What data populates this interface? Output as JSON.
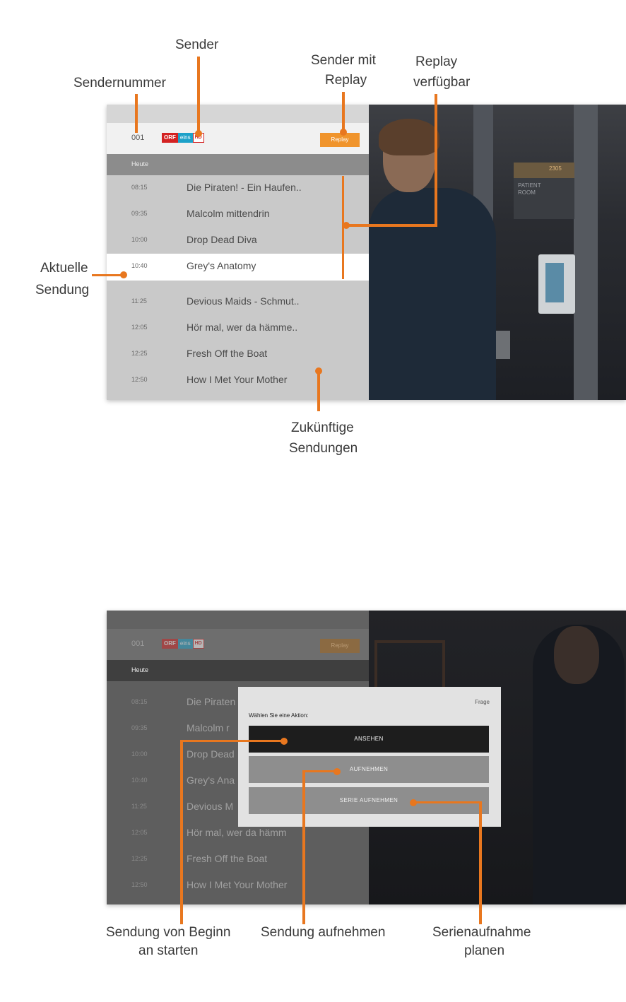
{
  "callouts": {
    "sendernummer": "Sendernummer",
    "sender": "Sender",
    "sender_mit_replay_1": "Sender mit",
    "sender_mit_replay_2": "Replay",
    "replay_verfuegbar_1": "Replay",
    "replay_verfuegbar_2": "verfügbar",
    "aktuelle_1": "Aktuelle",
    "aktuelle_2": "Sendung",
    "zukuenftige_1": "Zukünftige",
    "zukuenftige_2": "Sendungen",
    "von_beginn_1": "Sendung von Beginn",
    "von_beginn_2": "an starten",
    "aufnehmen": "Sendung aufnehmen",
    "serie_1": "Serienaufnahme",
    "serie_2": "planen"
  },
  "channel": {
    "number": "001",
    "logo_part1": "ORF",
    "logo_part2": "eins",
    "logo_part3": "HD",
    "replay_label": "Replay",
    "day_label": "Heute"
  },
  "programs": [
    {
      "time": "08:15",
      "title": "Die Piraten! - Ein Haufen.."
    },
    {
      "time": "09:35",
      "title": "Malcolm mittendrin"
    },
    {
      "time": "10:00",
      "title": "Drop Dead Diva"
    },
    {
      "time": "10:40",
      "title": "Grey's Anatomy"
    },
    {
      "time": "11:25",
      "title": "Devious Maids - Schmut.."
    },
    {
      "time": "12:05",
      "title": "Hör mal, wer da hämme.."
    },
    {
      "time": "12:25",
      "title": "Fresh Off the Boat"
    },
    {
      "time": "12:50",
      "title": "How I Met Your Mother"
    }
  ],
  "programs2": [
    {
      "time": "08:15",
      "title": "Die Piraten"
    },
    {
      "time": "09:35",
      "title": "Malcolm r"
    },
    {
      "time": "10:00",
      "title": "Drop Dead"
    },
    {
      "time": "10:40",
      "title": "Grey's Ana"
    },
    {
      "time": "11:25",
      "title": "Devious M"
    },
    {
      "time": "12:05",
      "title": "Hör mal, wer da hämm"
    },
    {
      "time": "12:25",
      "title": "Fresh Off the Boat"
    },
    {
      "time": "12:50",
      "title": "How I Met Your Mother"
    }
  ],
  "video": {
    "sign_text_1": "PATIENT",
    "sign_text_2": "ROOM",
    "sign_number": "2305"
  },
  "dialog": {
    "title": "Frage",
    "prompt": "Wählen Sie eine Aktion:",
    "btn_watch": "ANSEHEN",
    "btn_record": "AUFNEHMEN",
    "btn_series": "SERIE AUFNEHMEN"
  },
  "colors": {
    "accent": "#e8771f",
    "replay": "#f0942c",
    "current_row": "#ffffff",
    "dialog_primary": "#1d1d1d"
  }
}
